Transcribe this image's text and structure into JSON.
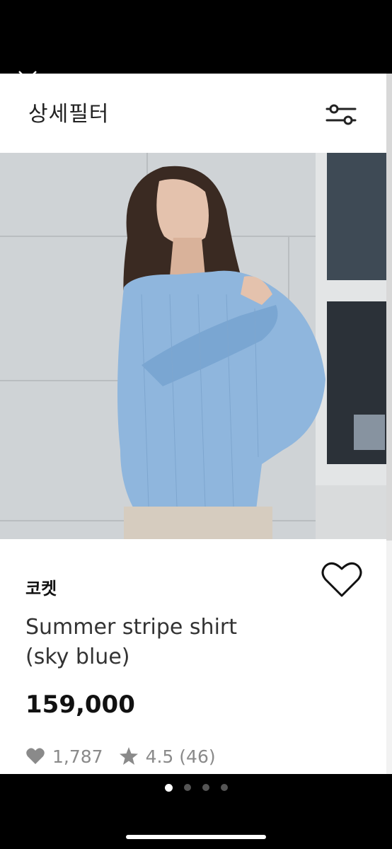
{
  "header": {
    "title": "상세필터"
  },
  "product": {
    "brand": "코켓",
    "name_line1": "Summer stripe shirt",
    "name_line2": "(sky blue)",
    "price": "159,000",
    "likes": "1,787",
    "rating": "4.5 (46)"
  },
  "carousel": {
    "total_pages": 4,
    "current_page": 1
  },
  "colors": {
    "shirt": "#8fb6dd",
    "wall": "#cfd3d6",
    "stats_gray": "#8a8a8a"
  }
}
